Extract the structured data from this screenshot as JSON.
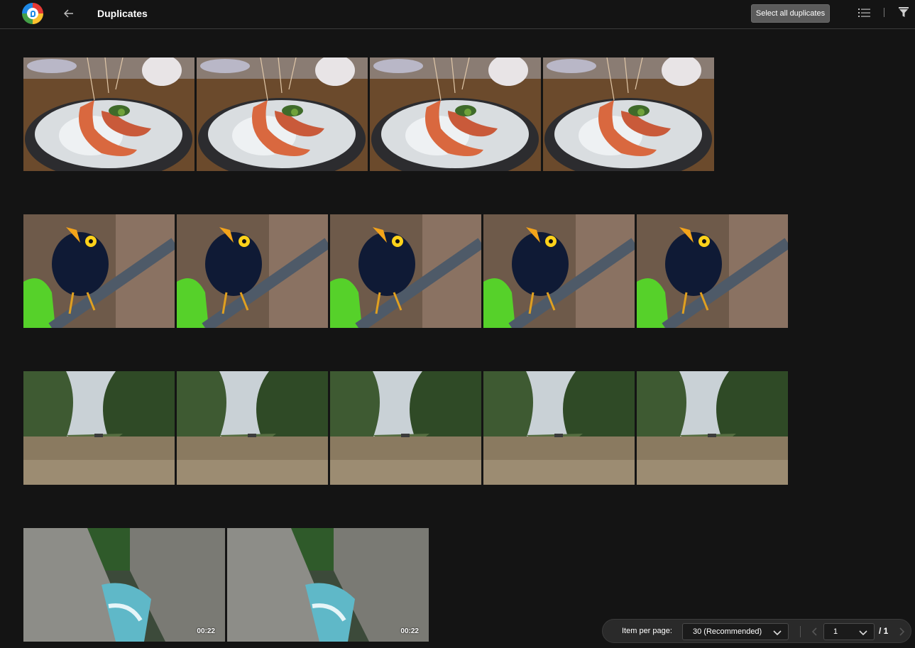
{
  "header": {
    "title": "Duplicates",
    "select_all_label": "Select all duplicates",
    "logo_icon": "app-logo-icon",
    "back_icon": "arrow-left-icon",
    "list_icon": "list-view-icon",
    "filter_icon": "filter-icon"
  },
  "groups": [
    {
      "subject": "shrimp-bowl",
      "count": 4,
      "items": [
        {},
        {},
        {},
        {}
      ]
    },
    {
      "subject": "black-bird",
      "count": 5,
      "items": [
        {},
        {},
        {},
        {},
        {}
      ]
    },
    {
      "subject": "river-palms",
      "count": 5,
      "items": [
        {},
        {},
        {},
        {},
        {}
      ]
    },
    {
      "subject": "rocky-gorge-video",
      "count": 2,
      "items": [
        {
          "duration": "00:22"
        },
        {
          "duration": "00:22"
        }
      ]
    }
  ],
  "pagination": {
    "items_per_page_label": "Item per page:",
    "items_per_page_value": "30 (Recommended)",
    "current_page": "1",
    "total_pages": "/ 1"
  },
  "colors": {
    "background": "#141414",
    "header_border": "#3a3a3a",
    "button_bg": "#5b5b5b",
    "pager_bg": "#2a2a2a"
  }
}
